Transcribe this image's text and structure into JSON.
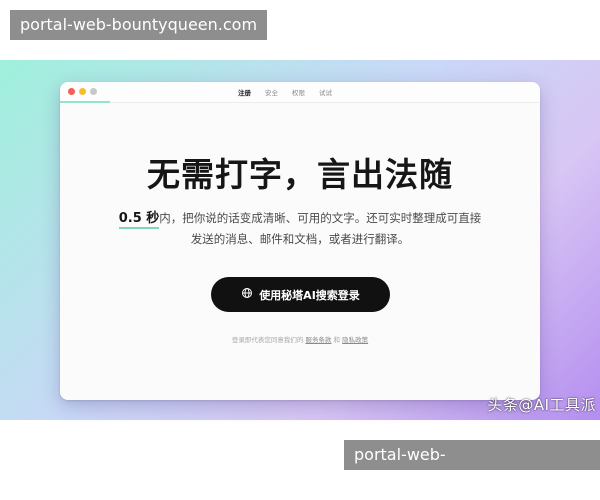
{
  "watermarks": {
    "top": "portal-web-bountyqueen.com",
    "bottom": "portal-web-bountyqueen.com"
  },
  "window": {
    "tabs": [
      "注册",
      "安全",
      "权限",
      "试试"
    ],
    "active_tab": "注册"
  },
  "hero": {
    "headline": "无需打字，言出法随",
    "subtitle_highlight": "0.5 秒",
    "subtitle_line1": "内，把你说的话变成清晰、可用的文字。还可实时整理成可直接",
    "subtitle_line2": "发送的消息、邮件和文档，或者进行翻译。"
  },
  "cta": {
    "label": "使用秘塔AI搜索登录",
    "icon": "globe-icon"
  },
  "terms": {
    "prefix": "登录即代表您同意我们的",
    "link1": "服务条款",
    "and": "和",
    "link2": "隐私政策"
  },
  "credit": "头条@AI工具派",
  "colors": {
    "accent_underline": "#7fd7b8",
    "cta_bg": "#111111",
    "frame_start": "#9ff0dc",
    "frame_end": "#b48ef0"
  }
}
